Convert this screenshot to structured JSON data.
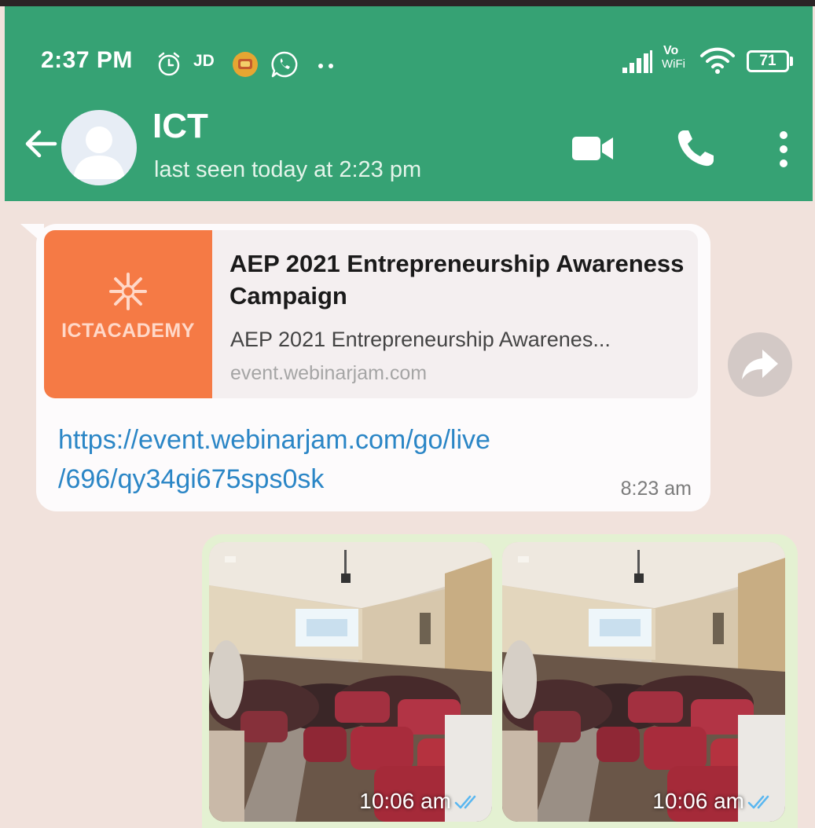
{
  "status_bar": {
    "time": "2:37 PM",
    "jd_label": "JD",
    "network_vo": "Vo",
    "network_wifi": "WiFi",
    "battery": "71",
    "icons": [
      "alarm-icon",
      "notification-app-icon",
      "whatsapp-icon",
      "more-dots-icon",
      "signal-icon",
      "wifi-icon",
      "battery-icon"
    ]
  },
  "chat_header": {
    "contact_name": "ICT",
    "last_seen": "last seen today at 2:23 pm",
    "icons": [
      "back-arrow-icon",
      "avatar-icon",
      "video-call-icon",
      "voice-call-icon",
      "menu-dots-icon"
    ],
    "color": "#36a274"
  },
  "messages": [
    {
      "direction": "incoming",
      "preview": {
        "brand": "ICTACADEMY",
        "title": "AEP 2021 Entrepreneurship Awareness Campaign",
        "description": "AEP 2021 Entrepreneurship Awarenes...",
        "domain": "event.webinarjam.com",
        "brand_color": "#f57a45"
      },
      "link_line1": "https://event.webinarjam.com/go/live",
      "link_line2": "/696/qy34gi675sps0sk",
      "time": "8:23 am",
      "link_color": "#2b86c6"
    },
    {
      "direction": "outgoing",
      "photos": [
        {
          "time": "10:06 am"
        },
        {
          "time": "10:06 am"
        }
      ]
    }
  ]
}
